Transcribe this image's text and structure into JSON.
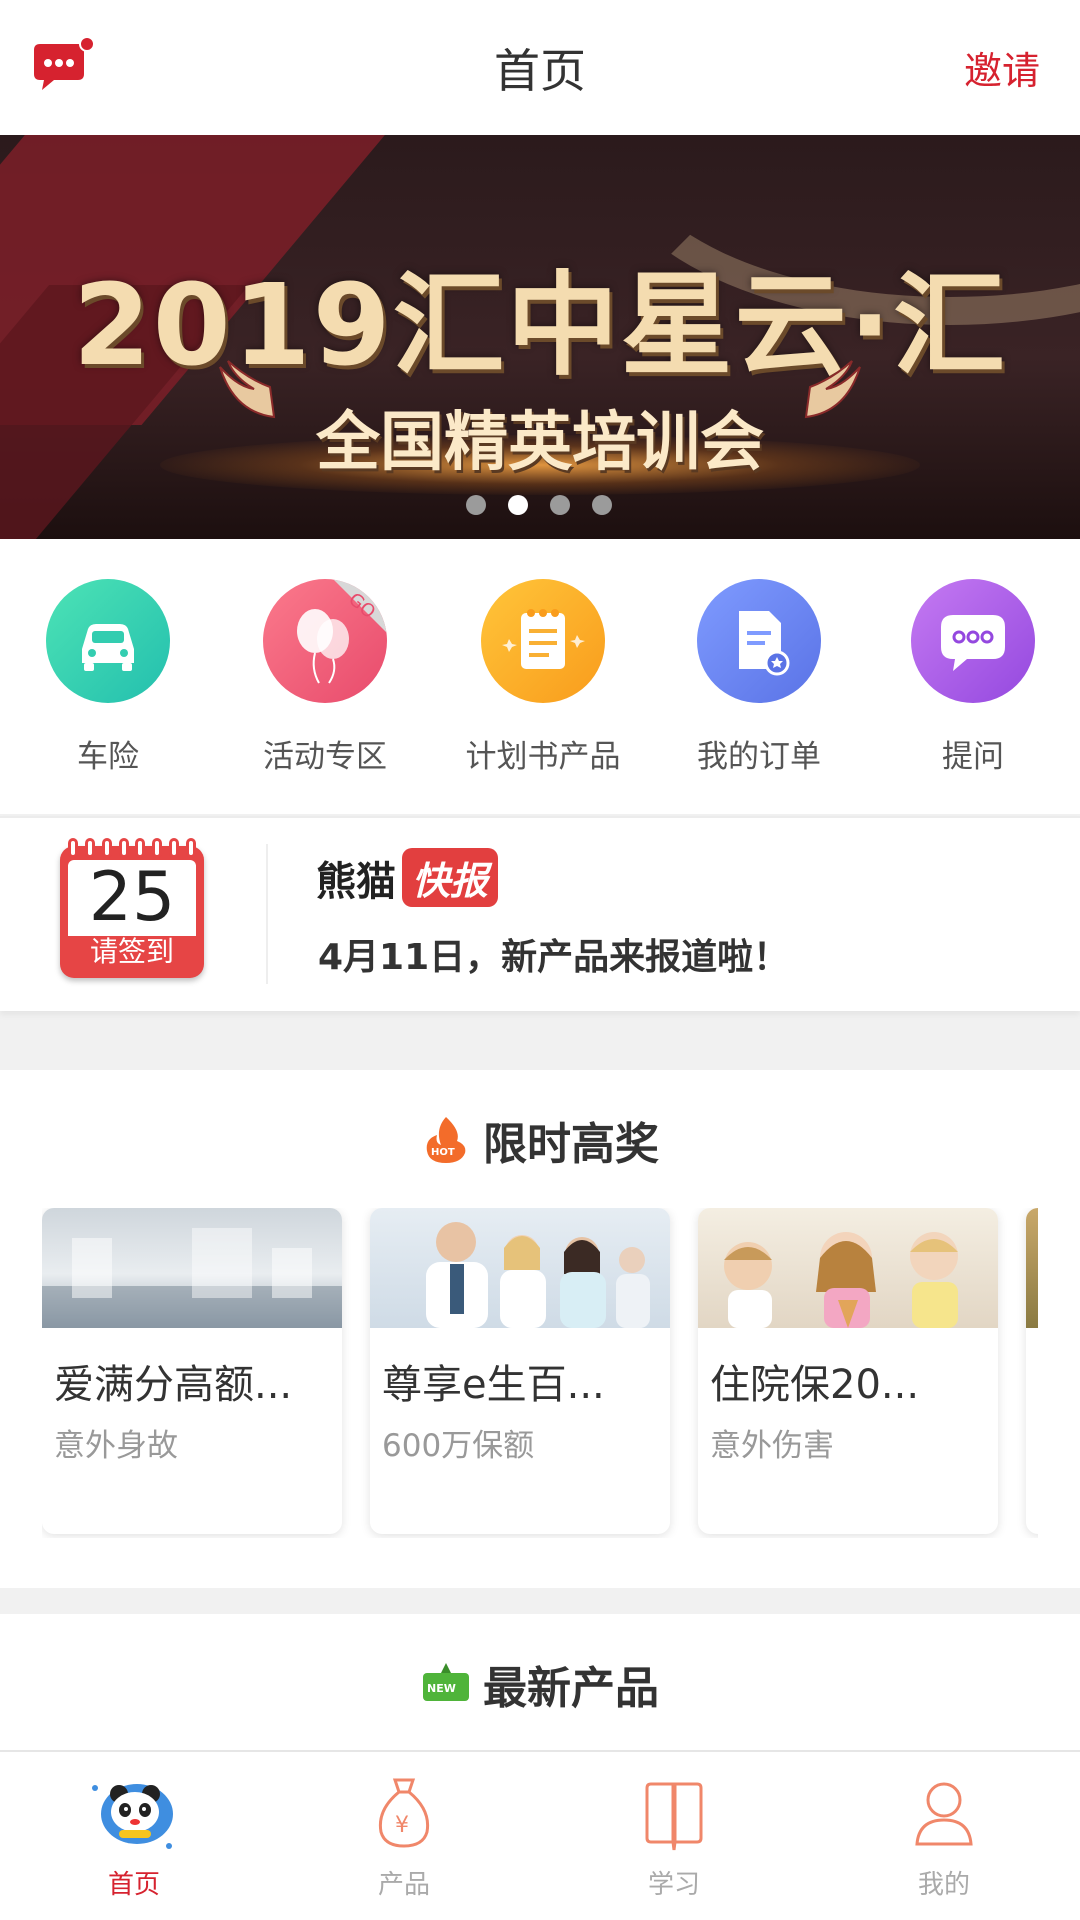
{
  "header": {
    "title": "首页",
    "invite": "邀请"
  },
  "banner": {
    "headline": "2019汇中星云·汇",
    "subtitle": "全国精英培训会",
    "slide_count": 4,
    "active_slide": 2
  },
  "quick": [
    {
      "label": "车险",
      "icon": "car-icon",
      "color": "#2ecba6"
    },
    {
      "label": "活动专区",
      "icon": "balloon-icon",
      "color": "#ef5f78"
    },
    {
      "label": "计划书产品",
      "icon": "notepad-icon",
      "color": "#fbae24"
    },
    {
      "label": "我的订单",
      "icon": "order-icon",
      "color": "#6b86ef"
    },
    {
      "label": "提问",
      "icon": "chat-icon",
      "color": "#a35be6"
    }
  ],
  "signin": {
    "day": "25",
    "label": "请签到"
  },
  "news": {
    "brand": "熊猫",
    "tag": "快报",
    "text": "4月11日，新产品来报道啦！"
  },
  "hot": {
    "title": "限时高奖",
    "badge": "HOT",
    "items": [
      {
        "name": "爱满分高额...",
        "desc": "意外身故"
      },
      {
        "name": "尊享e生百...",
        "desc": "600万保额"
      },
      {
        "name": "住院保20...",
        "desc": "意外伤害"
      }
    ]
  },
  "latest": {
    "title": "最新产品",
    "badge": "NEW"
  },
  "tabs": [
    {
      "label": "首页",
      "icon": "panda-icon"
    },
    {
      "label": "产品",
      "icon": "money-bag-icon"
    },
    {
      "label": "学习",
      "icon": "book-icon"
    },
    {
      "label": "我的",
      "icon": "user-icon"
    }
  ]
}
